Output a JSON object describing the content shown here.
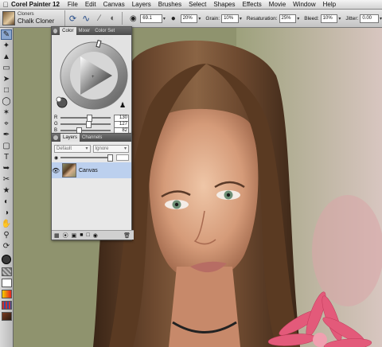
{
  "menubar": {
    "app_name": "Corel Painter 12",
    "items": [
      "File",
      "Edit",
      "Canvas",
      "Layers",
      "Brushes",
      "Select",
      "Shapes",
      "Effects",
      "Movie",
      "Window",
      "Help"
    ]
  },
  "propbar": {
    "brush_category": "Cloners",
    "brush_variant": "Chalk Cloner",
    "size_value": "69.1",
    "opacity_value": "20%",
    "grain_label": "Grain:",
    "grain_value": "10%",
    "resaturation_label": "Resaturation:",
    "resaturation_value": "25%",
    "bleed_label": "Bleed:",
    "bleed_value": "10%",
    "jitter_label": "Jitter:",
    "jitter_value": "0.00"
  },
  "color_panel": {
    "tabs": [
      "Color",
      "Mixer",
      "Color Set Libraries"
    ],
    "active_tab": "Color",
    "r_label": "R",
    "g_label": "G",
    "b_label": "B",
    "r_value": "130",
    "g_value": "127",
    "b_value": "82",
    "current_color": "#827f52"
  },
  "layers_panel": {
    "tabs": [
      "Layers",
      "Channels"
    ],
    "active_tab": "Layers",
    "composite_method": "Default",
    "composite_depth": "Ignore",
    "layers": [
      {
        "name": "Canvas",
        "visible": true,
        "selected": true
      }
    ]
  },
  "colors": {
    "selection_blue": "#bcd0ee",
    "panel_bg": "#e2e2e2"
  }
}
